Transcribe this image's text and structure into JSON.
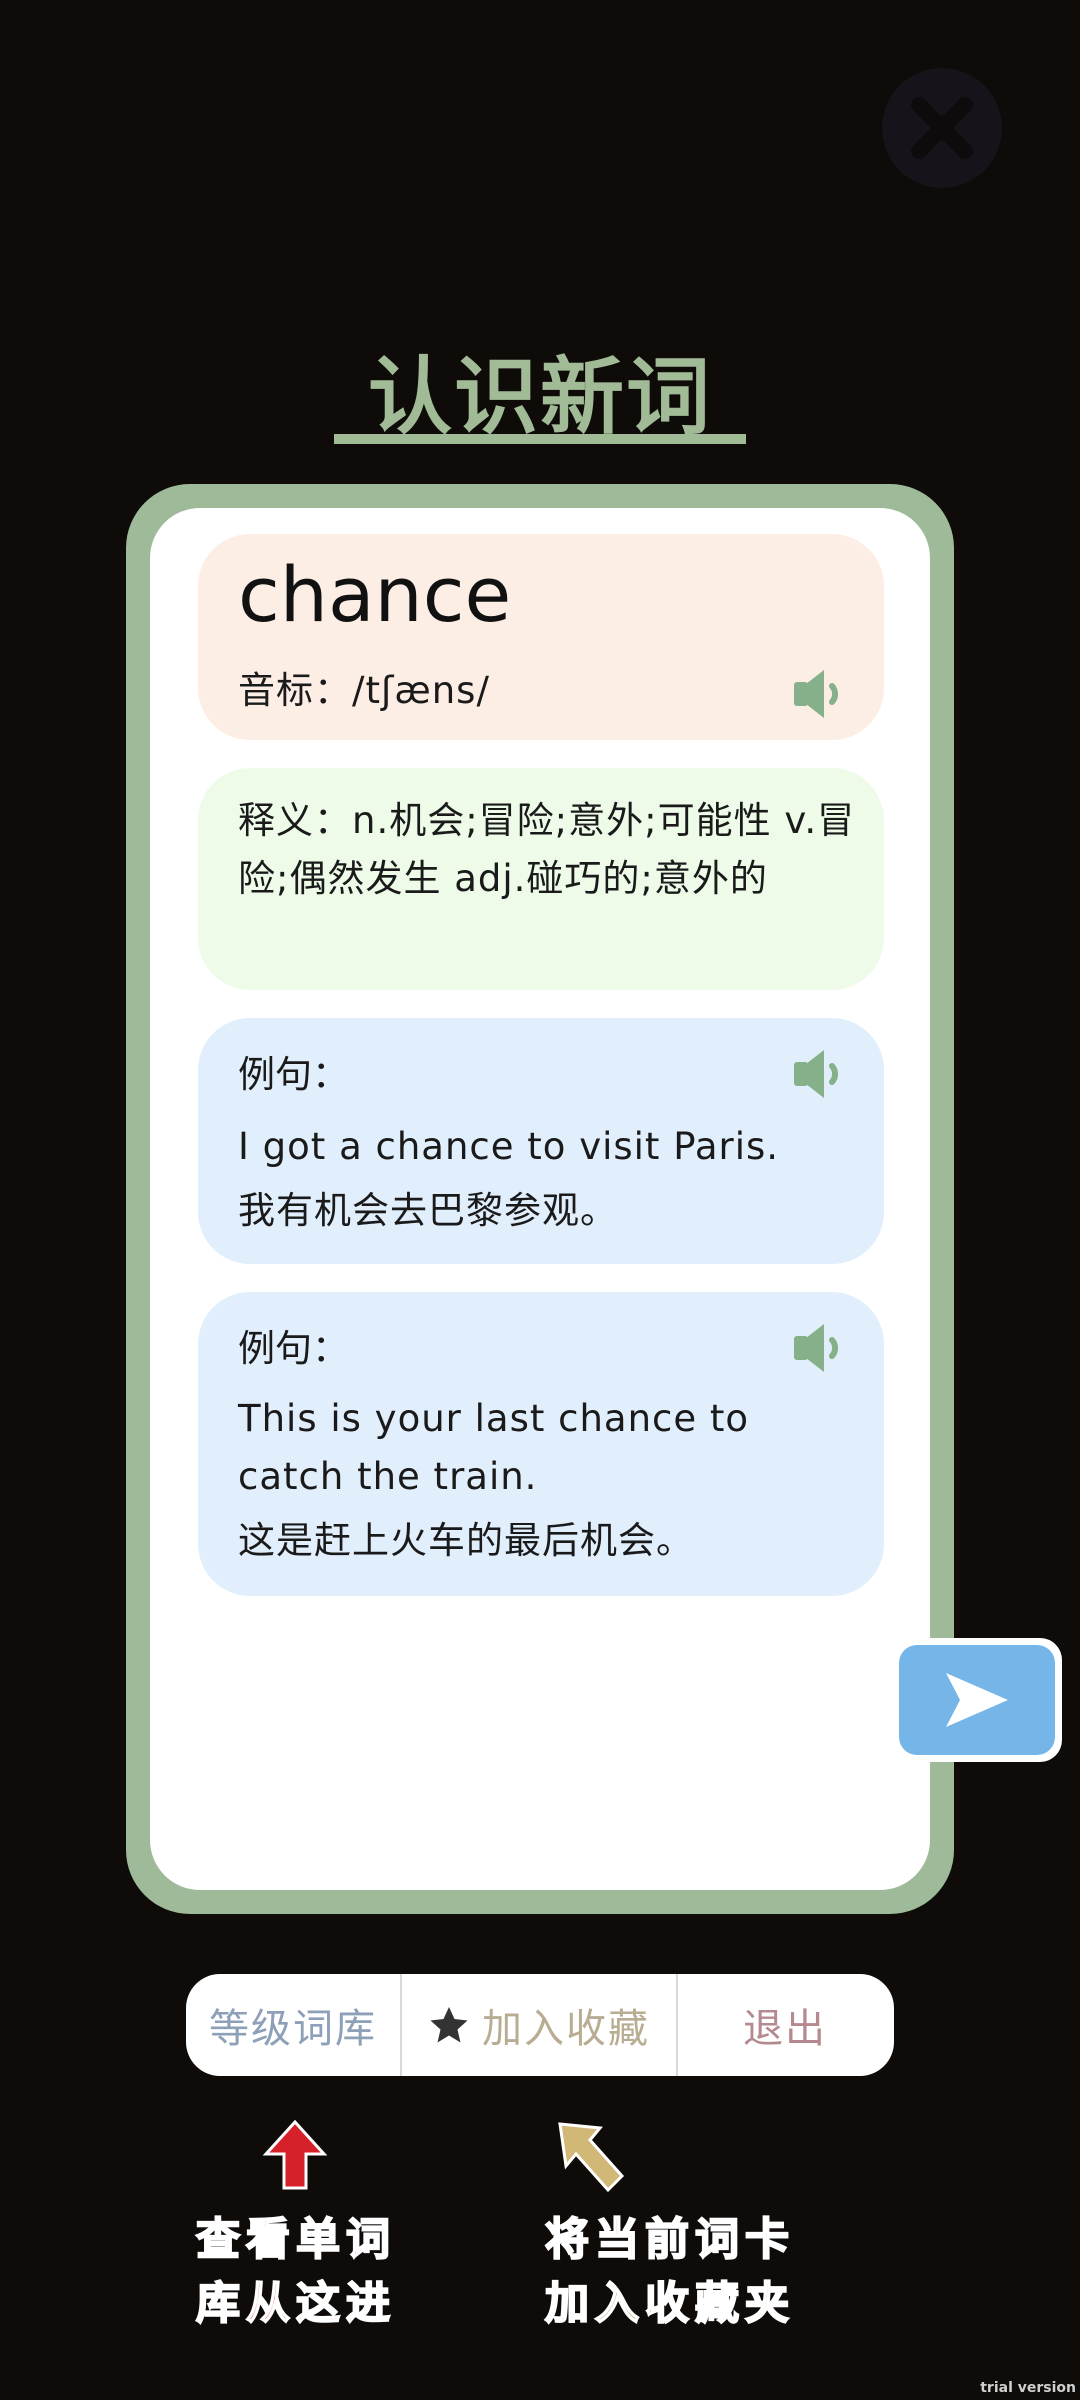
{
  "page": {
    "title": "认识新词",
    "watermark": "trial version"
  },
  "word_card": {
    "word": "chance",
    "phonetic_label": "音标：",
    "phonetic": "/tʃæns/",
    "definition_label": "释义：",
    "definition": "n.机会;冒险;意外;可能性 v.冒险;偶然发生 adj.碰巧的;意外的",
    "examples": [
      {
        "label": "例句：",
        "en": "I got a chance to visit Paris.",
        "zh": "我有机会去巴黎参观。"
      },
      {
        "label": "例句：",
        "en": "This is your last chance to catch the train.",
        "zh": "这是赶上火车的最后机会。"
      }
    ]
  },
  "toolbar": {
    "level_label": "等级词库",
    "favorite_label": "加入收藏",
    "exit_label": "退出"
  },
  "hints": {
    "left_line1": "查看单词",
    "left_line2": "库从这进",
    "right_line1": "将当前词卡",
    "right_line2": "加入收藏夹"
  },
  "colors": {
    "accent_green": "#a2bb97",
    "frame_green": "#9fba99",
    "next_blue": "#76b5e8",
    "hint_red": "#d6202a",
    "hint_gold": "#b69a55"
  },
  "icons": [
    "close-icon",
    "speaker-icon",
    "send-arrow-icon",
    "star-icon",
    "arrow-up-icon",
    "arrow-up-left-icon"
  ]
}
